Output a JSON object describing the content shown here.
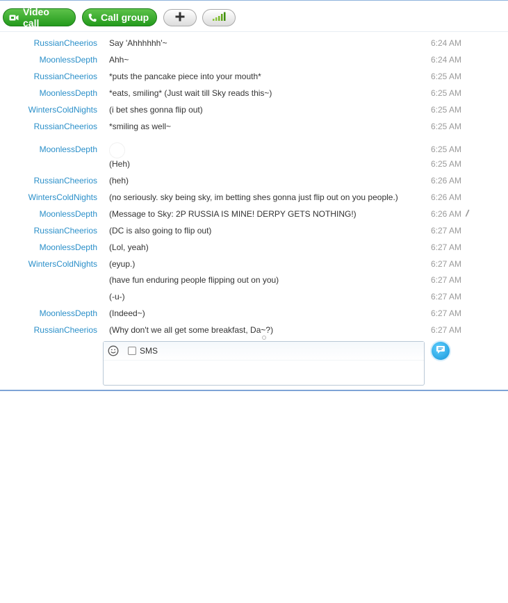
{
  "toolbar": {
    "video_call_label": "Video call",
    "call_group_label": "Call group",
    "add_icon": "plus-icon",
    "signal_icon": "signal-bars-icon"
  },
  "messages": [
    {
      "sender": "RussianCheerios",
      "text": "Say 'Ahhhhhh'~",
      "time": "6:24 AM"
    },
    {
      "sender": "MoonlessDepth",
      "text": "Ahh~",
      "time": "6:24 AM"
    },
    {
      "sender": "RussianCheerios",
      "text": "*puts the pancake piece into your mouth*",
      "time": "6:25 AM"
    },
    {
      "sender": "MoonlessDepth",
      "text": "*eats, smiling* (Just wait till Sky reads this~)",
      "time": "6:25 AM"
    },
    {
      "sender": "WintersColdNights",
      "text": "(i bet shes gonna flip out)",
      "time": "6:25 AM"
    },
    {
      "sender": "RussianCheerios",
      "text": "*smiling as well~",
      "time": "6:25 AM"
    },
    {
      "sender": "MoonlessDepth",
      "text": "",
      "time": "6:25 AM"
    },
    {
      "sender": "",
      "text": "(Heh)",
      "time": "6:25 AM"
    },
    {
      "sender": "RussianCheerios",
      "text": "(heh)",
      "time": "6:26 AM"
    },
    {
      "sender": "WintersColdNights",
      "text": "(no seriously. sky being sky, im betting shes gonna just flip out on you people.)",
      "time": "6:26 AM"
    },
    {
      "sender": "MoonlessDepth",
      "text": "(Message to Sky: 2P RUSSIA IS MINE! DERPY GETS NOTHING!)",
      "time": "6:26 AM"
    },
    {
      "sender": "RussianCheerios",
      "text": "(DC is also going to flip out)",
      "time": "6:27 AM"
    },
    {
      "sender": "MoonlessDepth",
      "text": "(Lol, yeah)",
      "time": "6:27 AM"
    },
    {
      "sender": "WintersColdNights",
      "text": "(eyup.)",
      "time": "6:27 AM"
    },
    {
      "sender": "",
      "text": "(have fun enduring people flipping out on you)",
      "time": "6:27 AM"
    },
    {
      "sender": "",
      "text": "(-u-)",
      "time": "6:27 AM"
    },
    {
      "sender": "MoonlessDepth",
      "text": "(Indeed~)",
      "time": "6:27 AM"
    },
    {
      "sender": "RussianCheerios",
      "text": "(Why don't we all get some breakfast, Da~?)",
      "time": "6:27 AM"
    }
  ],
  "composer": {
    "sms_label": "SMS",
    "sms_checked": false,
    "emoji_icon": "smiley-icon",
    "send_icon": "send-chat-icon"
  },
  "colors": {
    "sender": "#2a8fc9",
    "time": "#9a9a9a",
    "call_green": "#2ea325",
    "send_blue": "#1694d8"
  }
}
